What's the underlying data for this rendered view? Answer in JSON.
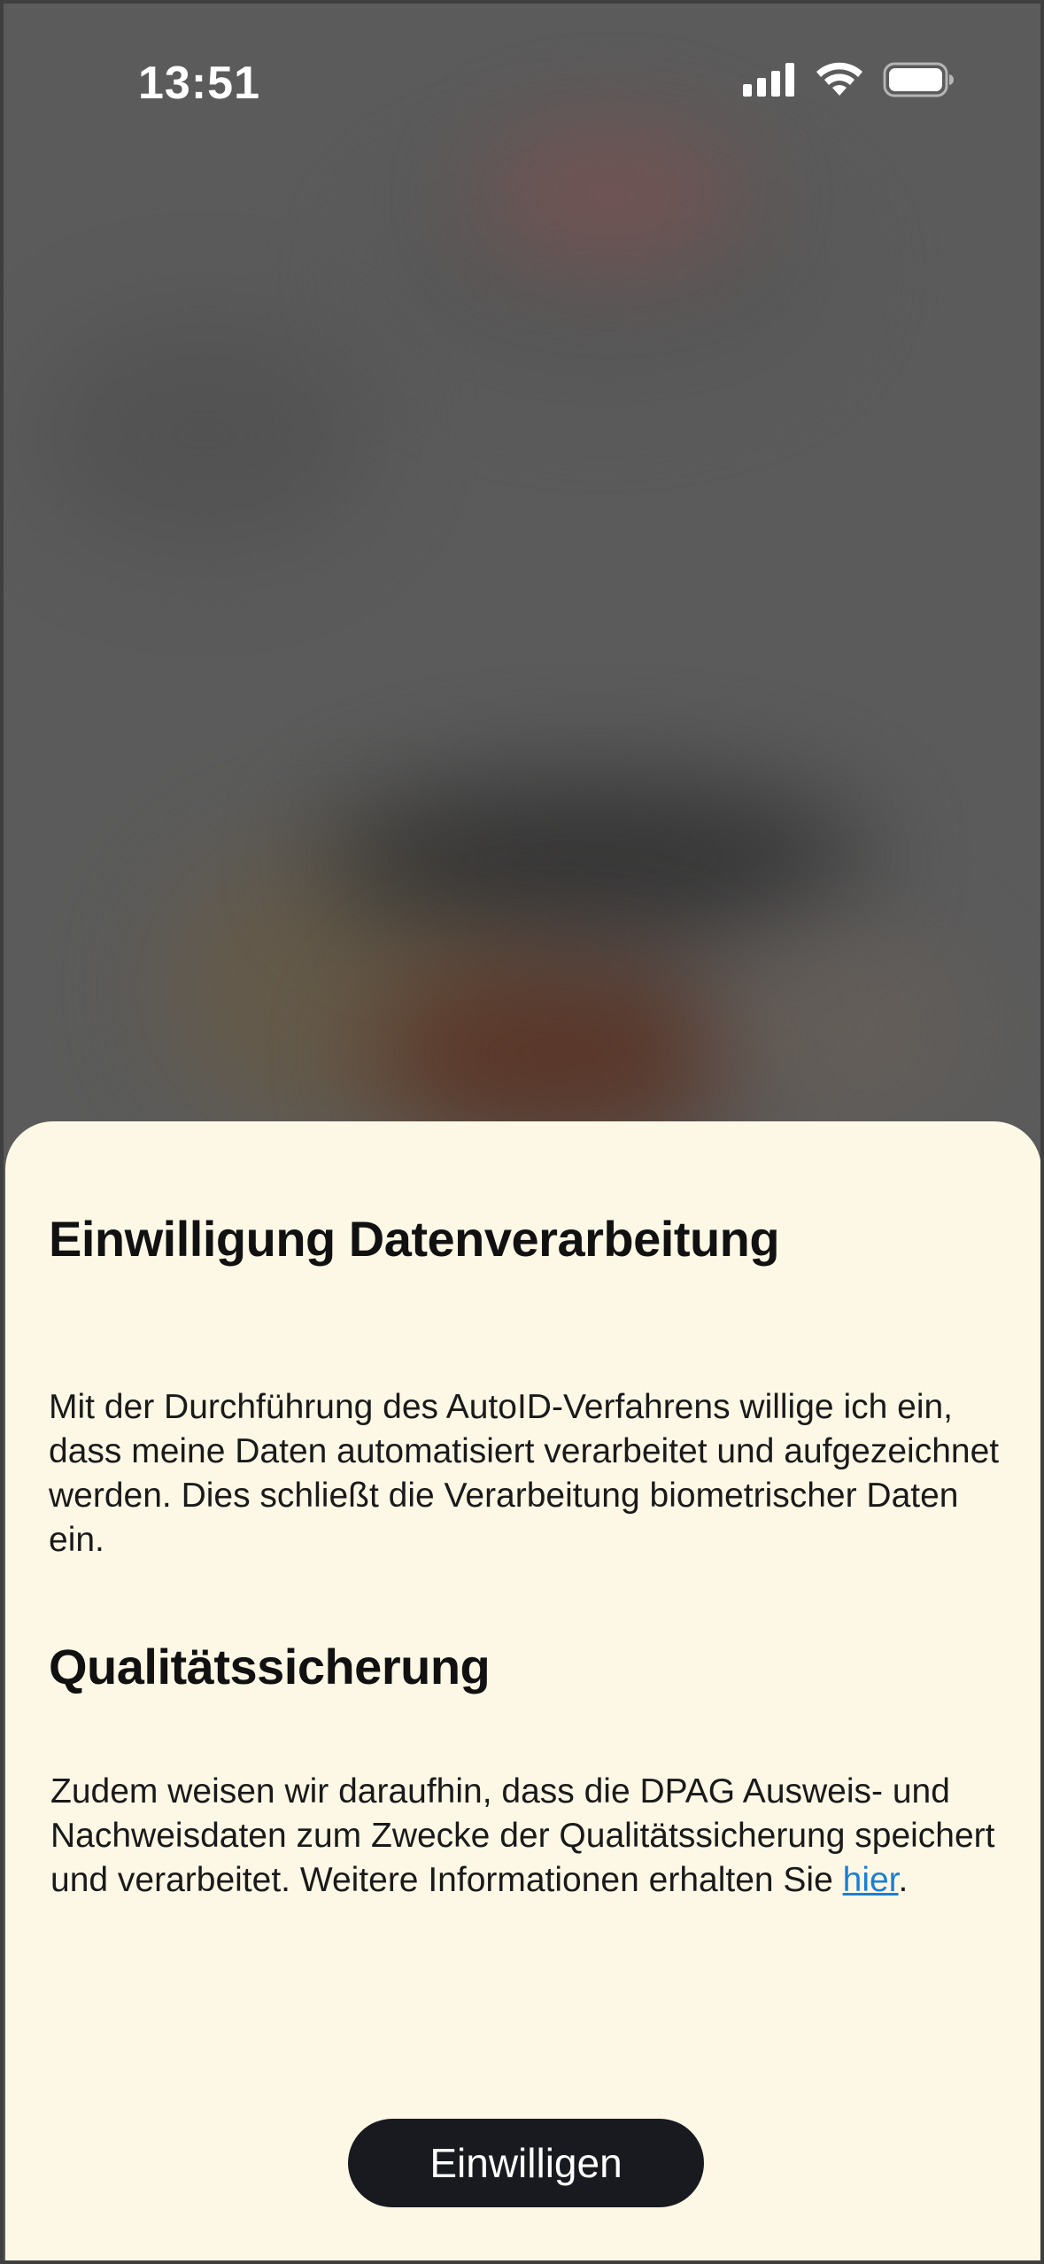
{
  "status_bar": {
    "time": "13:51",
    "icons": [
      "cellular-signal-icon",
      "wifi-icon",
      "battery-icon"
    ]
  },
  "sheet": {
    "title": "Einwilligung Datenverarbeitung",
    "paragraph1": "Mit der Durchführung des AutoID-Verfahrens willige ich ein, dass meine Daten automatisiert verarbeitet und aufgezeichnet werden. Dies schließt die Verarbeitung biometrischer Daten ein.",
    "section2_title": "Qualitätssicherung",
    "paragraph2_before_link": "Zudem weisen wir daraufhin, dass die DPAG Ausweis- und Nachweisdaten zum Zwecke der Qualitätssicherung speichert und verarbeitet. Weitere Informationen erhalten Sie ",
    "link_text": "hier",
    "paragraph2_after_link": ".",
    "button_label": "Einwilligen"
  },
  "colors": {
    "sheet_background": "#fdf8e6",
    "button_background": "#181a20",
    "link": "#1a7fd4"
  }
}
